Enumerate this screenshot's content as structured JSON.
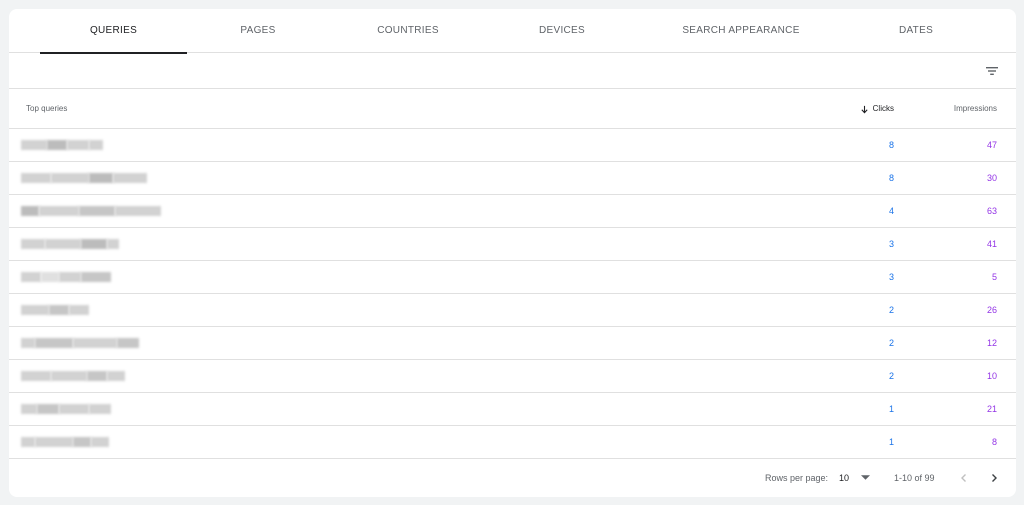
{
  "tabs": [
    {
      "label": "QUERIES",
      "active": true
    },
    {
      "label": "PAGES",
      "active": false
    },
    {
      "label": "COUNTRIES",
      "active": false
    },
    {
      "label": "DEVICES",
      "active": false
    },
    {
      "label": "SEARCH APPEARANCE",
      "active": false
    },
    {
      "label": "DATES",
      "active": false
    }
  ],
  "filter_icon": "filter-icon",
  "table": {
    "columns": {
      "query": "Top queries",
      "clicks": "Clicks",
      "impressions": "Impressions"
    },
    "sort_icon": "arrow-down-icon",
    "rows": [
      {
        "clicks": "8",
        "impressions": "47"
      },
      {
        "clicks": "8",
        "impressions": "30"
      },
      {
        "clicks": "4",
        "impressions": "63"
      },
      {
        "clicks": "3",
        "impressions": "41"
      },
      {
        "clicks": "3",
        "impressions": "5"
      },
      {
        "clicks": "2",
        "impressions": "26"
      },
      {
        "clicks": "2",
        "impressions": "12"
      },
      {
        "clicks": "2",
        "impressions": "10"
      },
      {
        "clicks": "1",
        "impressions": "21"
      },
      {
        "clicks": "1",
        "impressions": "8"
      }
    ]
  },
  "footer": {
    "rows_per_page_label": "Rows per page:",
    "rows_per_page_value": "10",
    "range": "1-10 of 99"
  },
  "colors": {
    "clicks": "#1a73e8",
    "impressions": "#9334e6"
  }
}
